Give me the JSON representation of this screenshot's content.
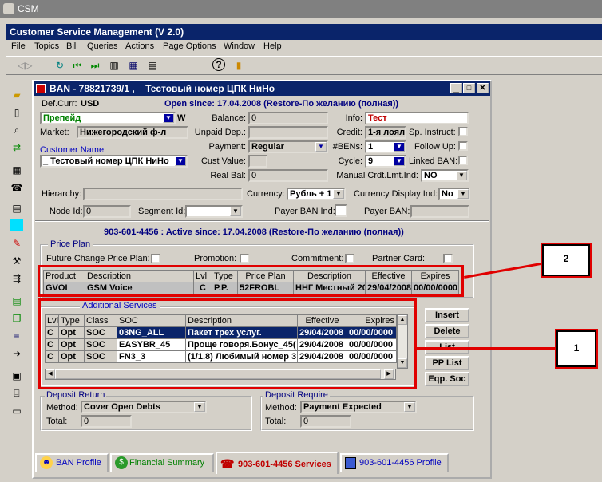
{
  "app": {
    "title": "CSM",
    "window_title": "Customer Service Management  (V 2.0)"
  },
  "menu": [
    "File",
    "Topics",
    "Bill",
    "Queries",
    "Actions",
    "Page Options",
    "Window",
    "Help"
  ],
  "child": {
    "title": "BAN - 78821739/1 , _ Тестовый номер ЦПК НиНо"
  },
  "header": {
    "defcurr_label": "Def.Curr:",
    "defcurr": "USD",
    "open_since": "Open since: 17.04.2008 (Restore-По желанию (полная))"
  },
  "left": {
    "plan": "Препейд",
    "w": "W",
    "market_label": "Market:",
    "market": "Нижегородский ф-л",
    "customer_name_label": "Customer Name",
    "customer_name": "_ Тестовый номер ЦПК НиНо"
  },
  "mid": {
    "balance_label": "Balance:",
    "balance": "0",
    "unpaid_label": "Unpaid Dep.:",
    "payment_label": "Payment:",
    "payment": "Regular",
    "cust_value_label": "Cust Value:",
    "real_bal_label": "Real Bal:",
    "real_bal": "0"
  },
  "right": {
    "info_label": "Info:",
    "info": "Тест",
    "credit_label": "Credit:",
    "credit": "1-я лоял",
    "sp_instruct_label": "Sp. Instruct:",
    "bens_label": "#BENs:",
    "bens": "1",
    "follow_up_label": "Follow Up:",
    "cycle_label": "Cycle:",
    "cycle": "9",
    "linked_ban_label": "Linked BAN:",
    "manual_label": "Manual Crdt.Lmt.Ind:",
    "manual": "NO"
  },
  "row2": {
    "hierarchy_label": "Hierarchy:",
    "currency_label": "Currency:",
    "currency": "Рубль + 1",
    "cdi_label": "Currency Display Ind:",
    "cdi": "No",
    "node_label": "Node Id:",
    "node": "0",
    "segment_label": "Segment Id:",
    "payer_ind_label": "Payer BAN Ind:",
    "payer_ban_label": "Payer BAN:"
  },
  "subscriber": {
    "line": "903-601-4456 : Active since: 17.04.2008 (Restore-По желанию (полная))"
  },
  "price_plan": {
    "title": "Price Plan",
    "future_label": "Future Change Price Plan:",
    "promotion_label": "Promotion:",
    "commitment_label": "Commitment:",
    "partner_label": "Partner Card:",
    "headers": [
      "Product",
      "Description",
      "Lvl",
      "Type",
      "Price Plan",
      "Description",
      "Effective",
      "Expires"
    ],
    "row": [
      "GVOI",
      "GSM Voice",
      "C",
      "P.P.",
      "52FROBL",
      "ННГ Местный 20",
      "29/04/2008",
      "00/00/0000"
    ]
  },
  "additional": {
    "title": "Additional Services",
    "headers": [
      "Lvl",
      "Type",
      "Class",
      "SOC",
      "Description",
      "Effective",
      "Expires"
    ],
    "rows": [
      [
        "C",
        "Opt",
        "SOC",
        "03NG_ALL",
        "Пакет трех услуг.",
        "29/04/2008",
        "00/00/0000"
      ],
      [
        "C",
        "Opt",
        "SOC",
        "EASYBR_45",
        "Проще говоря.Бонус_45(",
        "29/04/2008",
        "00/00/0000"
      ],
      [
        "C",
        "Opt",
        "SOC",
        "FN3_3",
        "(1/1.8) Любимый номер 3",
        "29/04/2008",
        "00/00/0000"
      ]
    ]
  },
  "buttons": {
    "insert": "Insert",
    "delete": "Delete",
    "list": "List",
    "pp_list": "PP List",
    "eqp_soc": "Eqp. Soc"
  },
  "deposit_return": {
    "title": "Deposit Return",
    "method_label": "Method:",
    "method": "Cover Open Debts",
    "total_label": "Total:",
    "total": "0"
  },
  "deposit_require": {
    "title": "Deposit Require",
    "method_label": "Method:",
    "method": "Payment Expected",
    "total_label": "Total:",
    "total": "0"
  },
  "tabs": [
    "BAN Profile",
    "Financial Summary",
    "903-601-4456 Services",
    "903-601-4456 Profile"
  ],
  "annotations": {
    "a1": "1",
    "a2": "2"
  }
}
